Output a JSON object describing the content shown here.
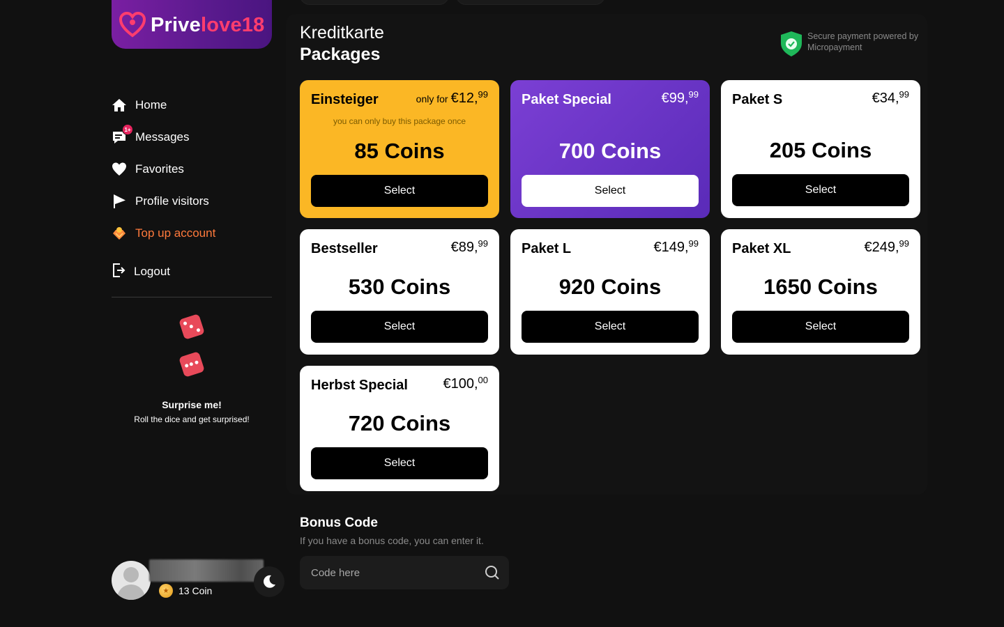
{
  "brand": {
    "name_white": "Prive",
    "name_pink": "love18"
  },
  "sidebar": {
    "items": [
      {
        "label": "Home",
        "icon": "home-icon"
      },
      {
        "label": "Messages",
        "icon": "messages-icon",
        "badge": "1+"
      },
      {
        "label": "Favorites",
        "icon": "heart-icon"
      },
      {
        "label": "Profile visitors",
        "icon": "flag-icon"
      },
      {
        "label": "Top up account",
        "icon": "coins-icon",
        "active": true
      }
    ],
    "logout": "Logout",
    "surprise_title": "Surprise me!",
    "surprise_sub": "Roll the dice and get surprised!"
  },
  "user": {
    "coins": "13 Coin"
  },
  "main": {
    "payment_method": "Kreditkarte",
    "packages_title": "Packages",
    "secure_text": "Secure payment powered by Micropayment"
  },
  "packages": [
    {
      "name": "Einsteiger",
      "prefix": "only for",
      "price_main": "€12,",
      "price_cents": "99",
      "note": "you can only buy this package once",
      "coins": "85 Coins",
      "button": "Select",
      "style": "gold"
    },
    {
      "name": "Paket Special",
      "prefix": "",
      "price_main": "€99,",
      "price_cents": "99",
      "note": "",
      "coins": "700 Coins",
      "button": "Select",
      "style": "purple"
    },
    {
      "name": "Paket S",
      "prefix": "",
      "price_main": "€34,",
      "price_cents": "99",
      "note": "",
      "coins": "205 Coins",
      "button": "Select",
      "style": "white"
    },
    {
      "name": "Bestseller",
      "prefix": "",
      "price_main": "€89,",
      "price_cents": "99",
      "note": "",
      "coins": "530 Coins",
      "button": "Select",
      "style": "white"
    },
    {
      "name": "Paket L",
      "prefix": "",
      "price_main": "€149,",
      "price_cents": "99",
      "note": "",
      "coins": "920 Coins",
      "button": "Select",
      "style": "white"
    },
    {
      "name": "Paket XL",
      "prefix": "",
      "price_main": "€249,",
      "price_cents": "99",
      "note": "",
      "coins": "1650 Coins",
      "button": "Select",
      "style": "white"
    },
    {
      "name": "Herbst Special",
      "prefix": "",
      "price_main": "€100,",
      "price_cents": "00",
      "note": "",
      "coins": "720 Coins",
      "button": "Select",
      "style": "white"
    }
  ],
  "bonus": {
    "title": "Bonus Code",
    "subtitle": "If you have a bonus code, you can enter it.",
    "placeholder": "Code here"
  },
  "colors": {
    "background": "#111111",
    "gold": "#fbb725",
    "purple": "#6a35c6",
    "accent_orange": "#ff7a3c",
    "brand_pink": "#ff3d6e"
  }
}
